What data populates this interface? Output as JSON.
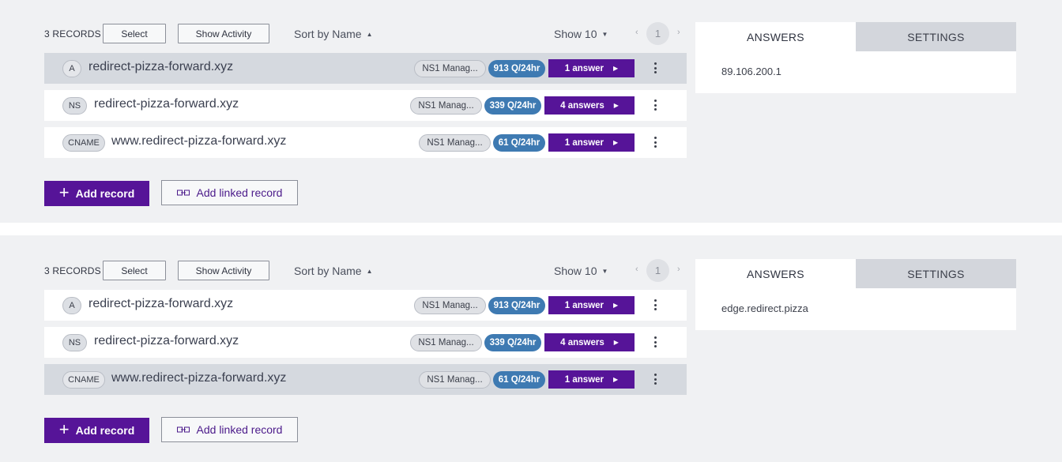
{
  "panels": [
    {
      "records_count": "3 RECORDS",
      "select_label": "Select",
      "activity_label": "Show Activity",
      "sort_label": "Sort by Name",
      "show_label": "Show 10",
      "page": "1",
      "rows": [
        {
          "type": "A",
          "domain": "redirect-pizza-forward.xyz",
          "network": "NS1 Manag...",
          "queries": "913 Q/24hr",
          "answers": "1 answer",
          "selected": true
        },
        {
          "type": "NS",
          "domain": "redirect-pizza-forward.xyz",
          "network": "NS1 Manag...",
          "queries": "339 Q/24hr",
          "answers": "4 answers",
          "selected": false
        },
        {
          "type": "CNAME",
          "domain": "www.redirect-pizza-forward.xyz",
          "network": "NS1 Manag...",
          "queries": "61 Q/24hr",
          "answers": "1 answer",
          "selected": false
        }
      ],
      "add_label": "Add record",
      "linked_label": "Add linked record",
      "tab_answers": "ANSWERS",
      "tab_settings": "SETTINGS",
      "answer_value": "89.106.200.1"
    },
    {
      "records_count": "3 RECORDS",
      "select_label": "Select",
      "activity_label": "Show Activity",
      "sort_label": "Sort by Name",
      "show_label": "Show 10",
      "page": "1",
      "rows": [
        {
          "type": "A",
          "domain": "redirect-pizza-forward.xyz",
          "network": "NS1 Manag...",
          "queries": "913 Q/24hr",
          "answers": "1 answer",
          "selected": false
        },
        {
          "type": "NS",
          "domain": "redirect-pizza-forward.xyz",
          "network": "NS1 Manag...",
          "queries": "339 Q/24hr",
          "answers": "4 answers",
          "selected": false
        },
        {
          "type": "CNAME",
          "domain": "www.redirect-pizza-forward.xyz",
          "network": "NS1 Manag...",
          "queries": "61 Q/24hr",
          "answers": "1 answer",
          "selected": true
        }
      ],
      "add_label": "Add record",
      "linked_label": "Add linked record",
      "tab_answers": "ANSWERS",
      "tab_settings": "SETTINGS",
      "answer_value": "edge.redirect.pizza"
    }
  ],
  "icons": {
    "sort_caret": "caret-up-icon",
    "show_caret": "caret-down-icon",
    "prev": "chevron-left-icon",
    "next": "chevron-right-icon",
    "row_arrow": "play-arrow-icon",
    "kebab": "kebab-menu-icon",
    "plus": "plus-icon",
    "link": "link-icon"
  },
  "colors": {
    "accent_purple": "#561498",
    "query_blue": "#3e7ab2",
    "selected_row": "#d5d9df",
    "background": "#f0f1f3"
  }
}
